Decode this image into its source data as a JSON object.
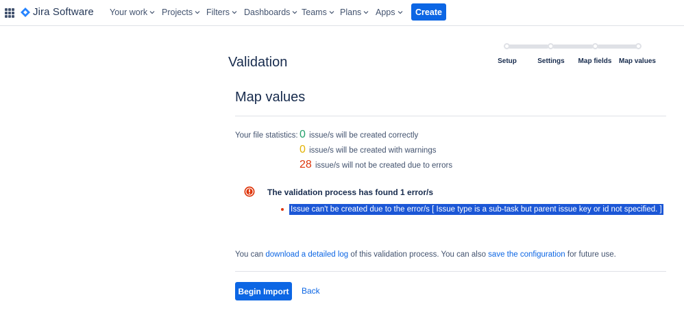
{
  "header": {
    "app_name": "Jira Software",
    "nav": [
      {
        "label": "Your work"
      },
      {
        "label": "Projects"
      },
      {
        "label": "Filters"
      },
      {
        "label": "Dashboards"
      },
      {
        "label": "Teams"
      },
      {
        "label": "Plans"
      },
      {
        "label": "Apps"
      }
    ],
    "create_label": "Create"
  },
  "page": {
    "title": "Validation",
    "steps": [
      {
        "label": "Setup"
      },
      {
        "label": "Settings"
      },
      {
        "label": "Map fields"
      },
      {
        "label": "Map values"
      }
    ],
    "section_title": "Map values"
  },
  "stats": {
    "label": "Your file statistics:",
    "rows": [
      {
        "count": "0",
        "text": "issue/s will be created correctly"
      },
      {
        "count": "0",
        "text": "issue/s will be created with warnings"
      },
      {
        "count": "28",
        "text": "issue/s will not be created due to errors"
      }
    ]
  },
  "validation": {
    "title": "The validation process has found 1 error/s",
    "errors": [
      "Issue can't be created due to the error/s [ Issue type is a sub-task but parent issue key or id not specified. ]"
    ]
  },
  "log": {
    "prefix": "You can",
    "download_link": "download a detailed log",
    "middle": "of this validation process. You can also",
    "save_link": "save the configuration",
    "suffix": "for future use."
  },
  "actions": {
    "begin_label": "Begin Import",
    "back_label": "Back"
  },
  "colors": {
    "primary": "#0c66e4",
    "success": "#22a06b",
    "warning": "#e2b203",
    "error": "#de350b"
  }
}
